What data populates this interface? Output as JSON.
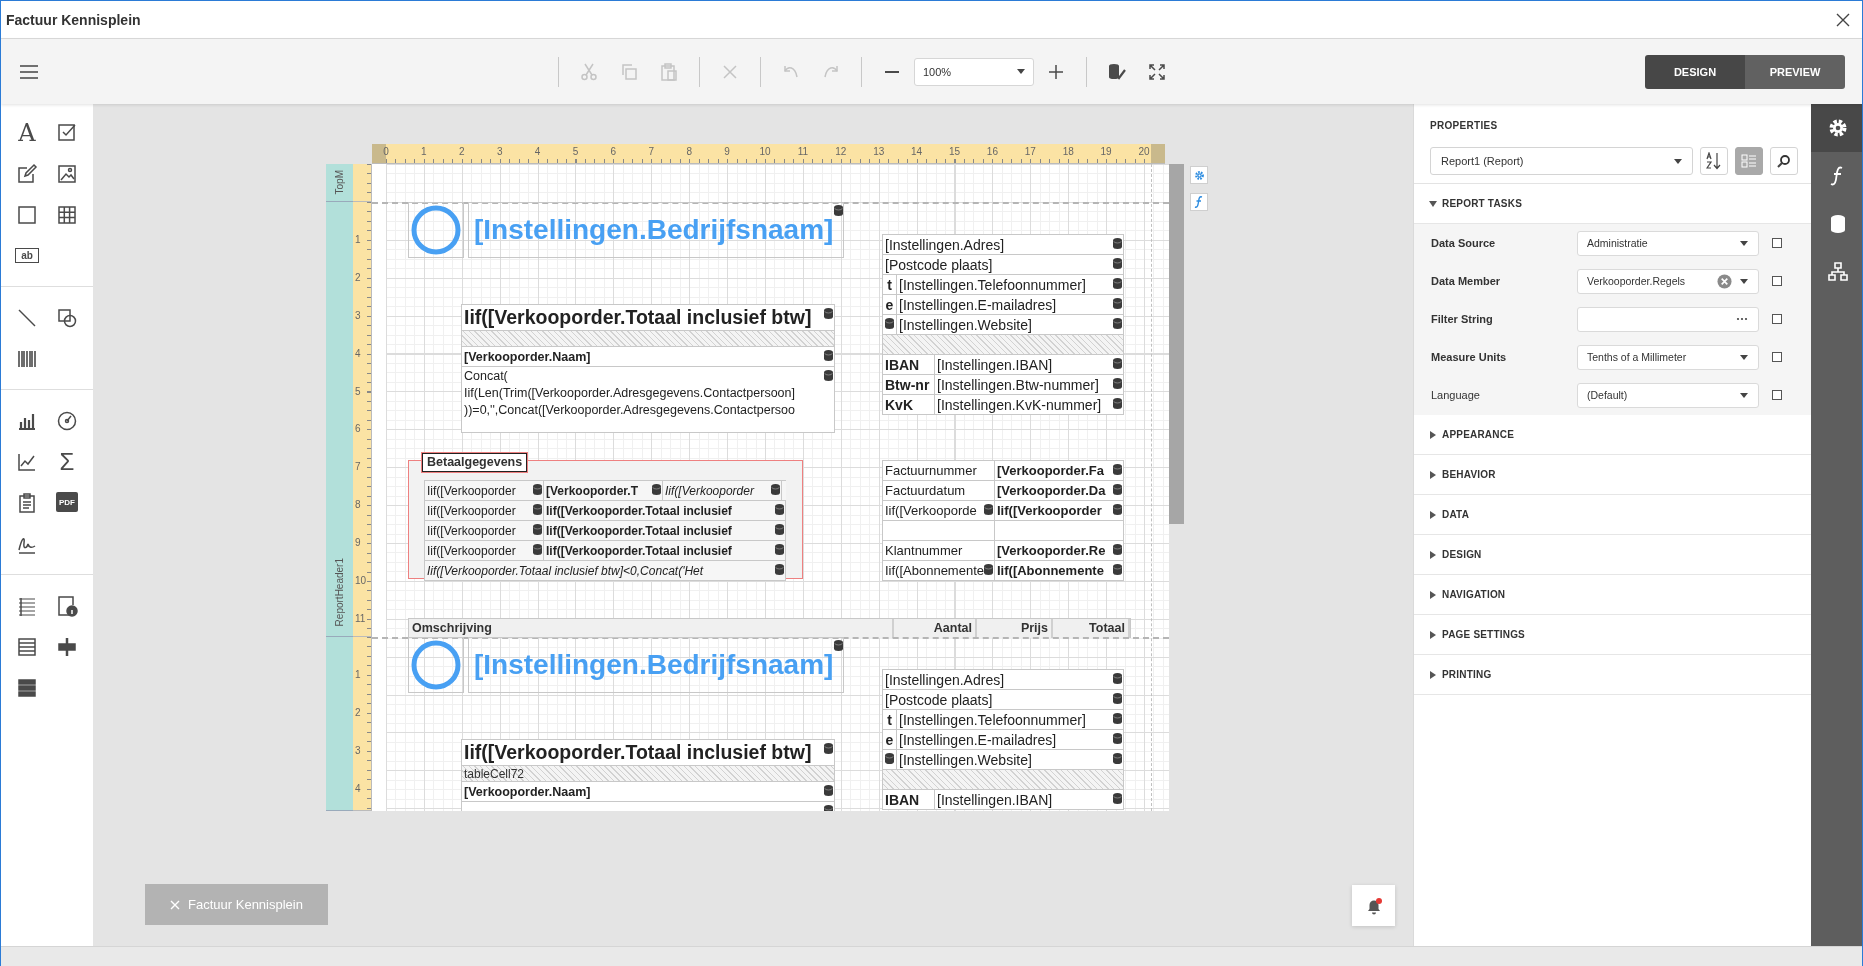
{
  "window": {
    "title": "Factuur Kennisplein"
  },
  "toolbar": {
    "buttons": [
      {
        "kind": "cut",
        "disabled": true,
        "separator_before": true
      },
      {
        "kind": "copy",
        "disabled": true
      },
      {
        "kind": "paste",
        "disabled": true
      },
      {
        "kind": "delete",
        "disabled": true,
        "separator_before": true
      },
      {
        "kind": "undo",
        "disabled": true,
        "separator_before": true
      },
      {
        "kind": "redo",
        "disabled": true
      },
      {
        "kind": "zoom_out",
        "disabled": false,
        "separator_before": true
      },
      {
        "kind": "zoom",
        "value": "100%"
      },
      {
        "kind": "zoom_in",
        "disabled": false
      },
      {
        "kind": "validate",
        "disabled": false,
        "separator_before": true
      },
      {
        "kind": "fullscreen",
        "disabled": false
      }
    ],
    "modes": [
      {
        "label": "DESIGN",
        "selected": true
      },
      {
        "label": "PREVIEW",
        "selected": false
      }
    ]
  },
  "toolbox": [
    [
      {
        "kind": "label",
        "text": "A"
      },
      {
        "kind": "checkbox"
      },
      {
        "kind": "richtext"
      },
      {
        "kind": "picture"
      },
      {
        "kind": "panel"
      },
      {
        "kind": "table"
      },
      {
        "kind": "comb",
        "text": "ab"
      }
    ],
    [
      {
        "kind": "line"
      },
      {
        "kind": "shape"
      },
      {
        "kind": "barcode"
      }
    ],
    [
      {
        "kind": "chart"
      },
      {
        "kind": "gauge"
      },
      {
        "kind": "sparkline"
      },
      {
        "kind": "summary",
        "text": "Σ"
      },
      {
        "kind": "contents"
      },
      {
        "kind": "pdf",
        "text": "PDF"
      },
      {
        "kind": "signature"
      }
    ],
    [
      {
        "kind": "subreport"
      },
      {
        "kind": "pageinfo"
      },
      {
        "kind": "crossband"
      },
      {
        "kind": "insertband"
      },
      {
        "kind": "bands"
      }
    ]
  ],
  "canvas": {
    "tools": [
      {
        "kind": "settings"
      },
      {
        "kind": "expression"
      }
    ],
    "document_tab": {
      "label": "Factuur Kennisplein"
    },
    "notifications": {
      "unread": true
    }
  },
  "report": {
    "ruler": [
      "0",
      "1",
      "2",
      "3",
      "4",
      "5",
      "6",
      "7",
      "8",
      "9",
      "10",
      "11",
      "12",
      "13",
      "14",
      "15",
      "16",
      "17",
      "18",
      "19",
      "20"
    ],
    "bands": [
      {
        "kind": "margin",
        "label": "TopM"
      },
      {
        "kind": "header",
        "label": "ReportHeader1",
        "ruler": [
          "1",
          "2",
          "3",
          "4",
          "5",
          "6",
          "7",
          "8",
          "9",
          "10",
          "11"
        ],
        "content": {
          "logo": {
            "title": "[Instellingen.Bedrijfsnaam]",
            "bound": true
          },
          "totals": [
            {
              "kind": "title",
              "text": "Iif([Verkooporder.Totaal inclusief btw]",
              "bound": true
            },
            {
              "kind": "hatch"
            },
            {
              "kind": "field",
              "text": "[Verkooporder.Naam]",
              "bound": true
            },
            {
              "kind": "multi",
              "text": "Concat(\nIif(Len(Trim([Verkooporder.Adresgegevens.Contactpersoon]\n))=0,'',Concat([Verkooporder.Adresgegevens.Contactpersoo",
              "bound": true
            }
          ],
          "address": [
            {
              "kind": "full",
              "value": "[Instellingen.Adres]",
              "bound": true
            },
            {
              "kind": "full",
              "value": "[Postcode plaats]",
              "bound": true
            },
            {
              "kind": "short",
              "label": "t",
              "value": "[Instellingen.Telefoonnummer]",
              "bound": true
            },
            {
              "kind": "short",
              "label": "e",
              "value": "[Instellingen.E-mailadres]",
              "bound": true
            },
            {
              "kind": "short",
              "label_bound": true,
              "value": "[Instellingen.Website]",
              "bound": true
            },
            {
              "kind": "hatch"
            },
            {
              "kind": "wide",
              "label": "IBAN",
              "value": "[Instellingen.IBAN]",
              "bound": true
            },
            {
              "kind": "wide",
              "label": "Btw-nr",
              "value": "[Instellingen.Btw-nummer]",
              "bound": true
            },
            {
              "kind": "wide",
              "label": "KvK",
              "value": "[Instellingen.KvK-nummer]",
              "bound": true
            }
          ],
          "payment": {
            "title": "Betaalgegevens",
            "rows": [
              [
                {
                  "text": "Iif([Verkooporder",
                  "kind": "plain",
                  "bound": true
                },
                {
                  "text": "[Verkooporder.T",
                  "kind": "strong",
                  "bound": true
                },
                {
                  "text": "Iif([Verkooporder",
                  "kind": "slanted",
                  "bound": true
                }
              ],
              [
                {
                  "text": "Iif([Verkooporder",
                  "kind": "plain",
                  "bound": true
                },
                {
                  "text": "Iif([Verkooporder.Totaal inclusief",
                  "kind": "strong",
                  "bound": true
                }
              ],
              [
                {
                  "text": "Iif([Verkooporder",
                  "kind": "plain",
                  "bound": true
                },
                {
                  "text": "Iif([Verkooporder.Totaal inclusief",
                  "kind": "strong",
                  "bound": true
                }
              ],
              [
                {
                  "text": "Iif([Verkooporder",
                  "kind": "plain",
                  "bound": true
                },
                {
                  "text": "Iif([Verkooporder.Totaal inclusief",
                  "kind": "strong",
                  "bound": true
                }
              ],
              [
                {
                  "text": "Iif([Verkooporder.Totaal inclusief btw]<0,Concat('Het",
                  "kind": "slanted",
                  "bound": true
                }
              ]
            ]
          },
          "invoice": [
            {
              "label": "Factuurnummer",
              "value": "[Verkooporder.Fa",
              "value_bound": true
            },
            {
              "label": "Factuurdatum",
              "value": "[Verkooporder.Da",
              "value_bound": true
            },
            {
              "label": "Iif([Verkooporde",
              "label_bound": true,
              "value": "Iif([Verkooporder",
              "value_bound": true
            },
            {
              "label": "Klantnummer",
              "value": "[Verkooporder.Re",
              "value_bound": true
            },
            {
              "label": "Iif([Abonnemente",
              "label_bound": true,
              "value": "Iif([Abonnemente",
              "value_bound": true
            }
          ],
          "columns": [
            "Omschrijving",
            "Aantal",
            "Prijs",
            "Totaal"
          ]
        }
      },
      {
        "kind": "detail",
        "ruler": [
          "1",
          "2",
          "3",
          "4"
        ],
        "content": {
          "logo": {
            "title": "[Instellingen.Bedrijfsnaam]",
            "bound": true
          },
          "totals": [
            {
              "kind": "title",
              "text": "Iif([Verkooporder.Totaal inclusief btw]",
              "bound": true
            },
            {
              "kind": "hatch",
              "text": "tableCell72"
            },
            {
              "kind": "field",
              "text": "[Verkooporder.Naam]",
              "bound": true
            },
            {
              "kind": "multi",
              "bound": true
            }
          ],
          "address": [
            {
              "kind": "full",
              "value": "[Instellingen.Adres]",
              "bound": true
            },
            {
              "kind": "full",
              "value": "[Postcode plaats]",
              "bound": true
            },
            {
              "kind": "short",
              "label": "t",
              "value": "[Instellingen.Telefoonnummer]",
              "bound": true
            },
            {
              "kind": "short",
              "label": "e",
              "value": "[Instellingen.E-mailadres]",
              "bound": true
            },
            {
              "kind": "short",
              "label_bound": true,
              "value": "[Instellingen.Website]",
              "bound": true
            },
            {
              "kind": "hatch"
            },
            {
              "kind": "wide",
              "label": "IBAN",
              "value": "[Instellingen.IBAN]",
              "bound": true
            }
          ]
        }
      }
    ]
  },
  "properties": {
    "title": "PROPERTIES",
    "object": "Report1 (Report)",
    "tools": [
      {
        "kind": "sort",
        "selected": false
      },
      {
        "kind": "categories",
        "selected": true
      },
      {
        "kind": "search",
        "selected": false
      }
    ],
    "sections": [
      {
        "title": "REPORT TASKS",
        "expanded": true,
        "rows": [
          {
            "label": "Data Source",
            "modified": true,
            "value": "Administratie",
            "kind": "dropdown",
            "checked": false
          },
          {
            "label": "Data Member",
            "modified": true,
            "value": "Verkooporder.Regels",
            "kind": "dropdown_clear",
            "checked": false
          },
          {
            "label": "Filter String",
            "modified": true,
            "kind": "ellipsis",
            "checked": false
          },
          {
            "label": "Measure Units",
            "modified": true,
            "value": "Tenths of a Millimeter",
            "kind": "dropdown",
            "checked": false
          },
          {
            "label": "Language",
            "modified": false,
            "value": "(Default)",
            "kind": "dropdown",
            "checked": false
          }
        ]
      },
      {
        "title": "APPEARANCE",
        "expanded": false
      },
      {
        "title": "BEHAVIOR",
        "expanded": false
      },
      {
        "title": "DATA",
        "expanded": false
      },
      {
        "title": "DESIGN",
        "expanded": false
      },
      {
        "title": "NAVIGATION",
        "expanded": false
      },
      {
        "title": "PAGE SETTINGS",
        "expanded": false
      },
      {
        "title": "PRINTING",
        "expanded": false
      }
    ]
  },
  "side_tabs": [
    {
      "kind": "properties",
      "selected": true
    },
    {
      "kind": "expressions",
      "selected": false
    },
    {
      "kind": "fields",
      "selected": false
    },
    {
      "kind": "outline",
      "selected": false
    }
  ]
}
